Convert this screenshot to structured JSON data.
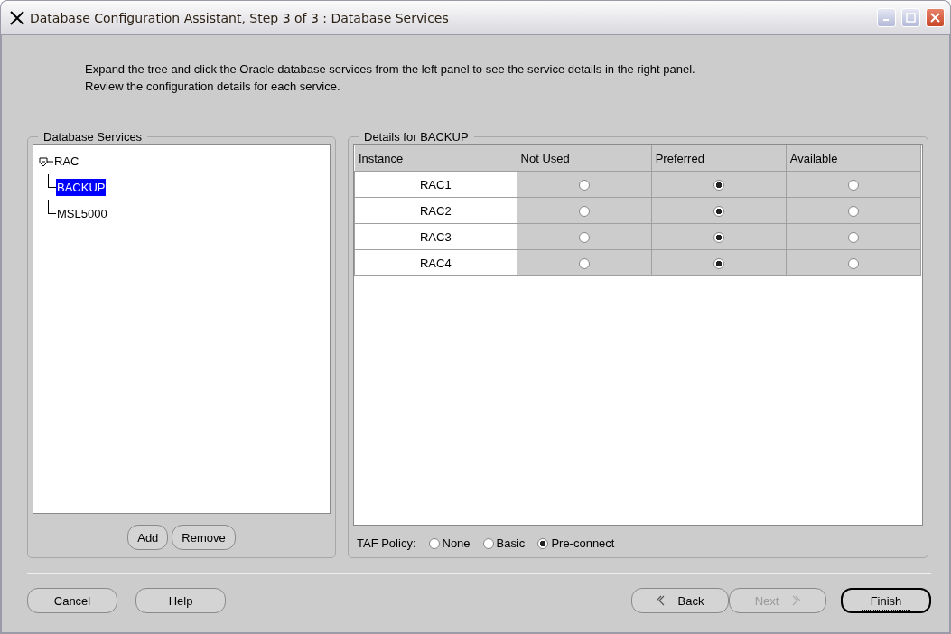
{
  "window": {
    "title": "Database Configuration Assistant, Step 3 of 3 : Database Services"
  },
  "intro": [
    "Expand the tree and click the Oracle database services from the left panel to see the service details in the right panel.",
    "Review the configuration details for each service."
  ],
  "services_panel": {
    "title": "Database Services",
    "tree": [
      {
        "label": "RAC",
        "expanded": true,
        "selected": false,
        "children": [
          {
            "label": "BACKUP",
            "selected": true
          },
          {
            "label": "MSL5000",
            "selected": false
          }
        ]
      }
    ],
    "buttons": [
      "Add",
      "Remove"
    ]
  },
  "details_panel": {
    "title": "Details for BACKUP",
    "table": {
      "columns": [
        "Instance",
        "Not Used",
        "Preferred",
        "Available"
      ],
      "rows": [
        {
          "instance": "RAC1",
          "choices": [
            {
              "selected": false
            },
            {
              "selected": true
            },
            {
              "selected": false
            }
          ]
        },
        {
          "instance": "RAC2",
          "choices": [
            {
              "selected": false
            },
            {
              "selected": true
            },
            {
              "selected": false
            }
          ]
        },
        {
          "instance": "RAC3",
          "choices": [
            {
              "selected": false
            },
            {
              "selected": true
            },
            {
              "selected": false
            }
          ]
        },
        {
          "instance": "RAC4",
          "choices": [
            {
              "selected": false
            },
            {
              "selected": true
            },
            {
              "selected": false
            }
          ]
        }
      ]
    },
    "taf_policy": {
      "label": "TAF Policy:",
      "options": [
        {
          "label": "None",
          "selected": false
        },
        {
          "label": "Basic",
          "selected": false
        },
        {
          "label": "Pre-connect",
          "selected": true
        }
      ]
    }
  },
  "footer": {
    "left": [
      {
        "label": "Cancel",
        "kind": "plain",
        "disabled": false,
        "focused": false
      },
      {
        "label": "Help",
        "kind": "plain",
        "disabled": false,
        "focused": false
      }
    ],
    "right": [
      {
        "label": "Back",
        "kind": "back",
        "disabled": false,
        "focused": false
      },
      {
        "label": "Next",
        "kind": "next",
        "disabled": true,
        "focused": false
      },
      {
        "label": "Finish",
        "kind": "plain",
        "disabled": false,
        "focused": true
      }
    ]
  }
}
